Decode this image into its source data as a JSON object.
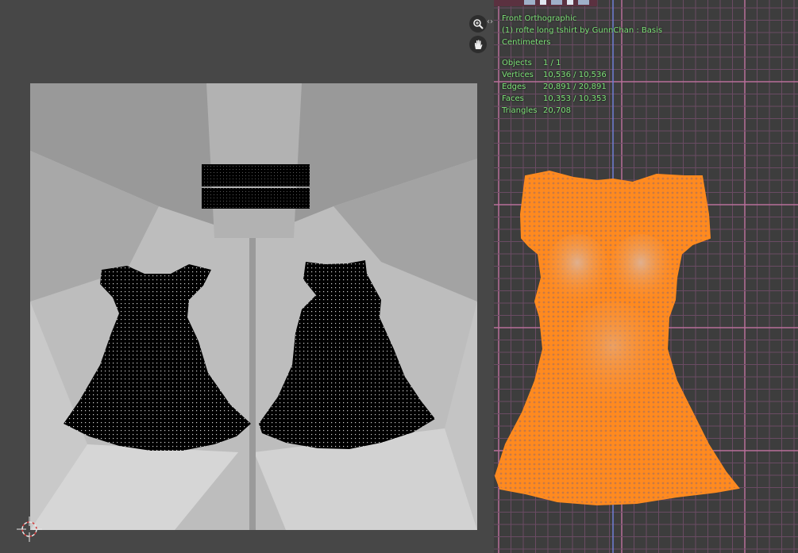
{
  "viewport": {
    "view_name": "Front Orthographic",
    "object_line": "(1) rofte long tshirt by GunnChan : Basis",
    "units": "Centimeters",
    "stats": [
      {
        "label": "Objects",
        "value": "1 / 1"
      },
      {
        "label": "Vertices",
        "value": "10,536 / 10,536"
      },
      {
        "label": "Edges",
        "value": "20,891 / 20,891"
      },
      {
        "label": "Faces",
        "value": "10,353 / 10,353"
      },
      {
        "label": "Triangles",
        "value": "20,708"
      }
    ]
  },
  "icons": {
    "zoom": "zoom-icon",
    "pan": "hand-icon",
    "collapse": "chevron-icon",
    "cursor": "3d-cursor-icon"
  },
  "colors": {
    "mesh": "#ff8a1f",
    "grid_minor": "#6a4b63",
    "grid_major": "#b86f9a",
    "overlay_text": "#7fe37a",
    "uv_island": "#000000"
  }
}
